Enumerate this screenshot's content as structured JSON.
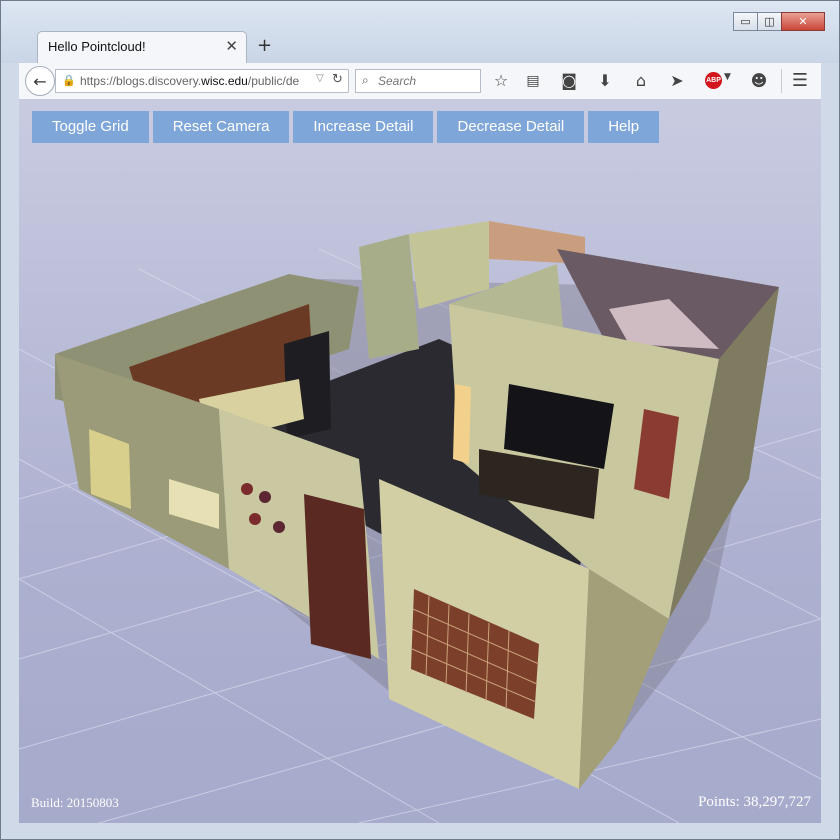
{
  "browser": {
    "tab_title": "Hello Pointcloud!",
    "url_prefix": "https://blogs.discovery.",
    "url_host": "wisc.edu",
    "url_suffix": "/public/de",
    "search_placeholder": "Search",
    "window_controls": {
      "minimize": "▭",
      "restore": "◫",
      "close": "✕"
    }
  },
  "toolbar_icons": [
    "bookmark-star-icon",
    "reading-list-icon",
    "pocket-icon",
    "download-icon",
    "home-icon",
    "send-icon",
    "adblock-icon",
    "smiley-icon",
    "menu-icon"
  ],
  "viewer": {
    "buttons": {
      "toggle_grid": "Toggle Grid",
      "reset_camera": "Reset Camera",
      "increase_detail": "Increase Detail",
      "decrease_detail": "Decrease Detail",
      "help": "Help"
    },
    "build_label": "Build: 20150803",
    "points_label": "Points: 38,297,727"
  },
  "abp_label": "ABP",
  "colors": {
    "button_bg": "#7fa6d9",
    "viewport_bg": "#b7b9d6"
  }
}
